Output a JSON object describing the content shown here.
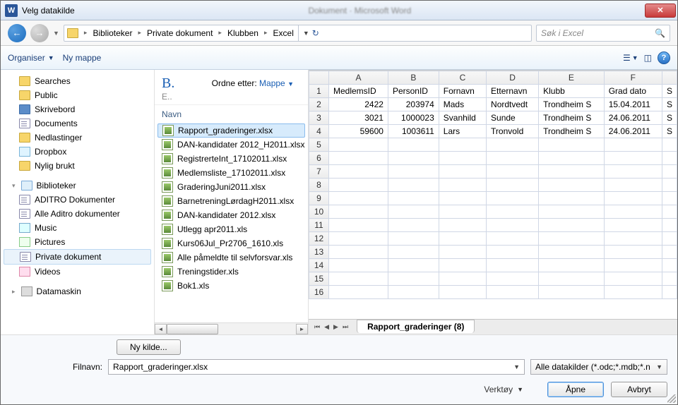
{
  "window": {
    "title": "Velg datakilde"
  },
  "address": {
    "crumbs": [
      "Biblioteker",
      "Private dokument",
      "Klubben",
      "Excel"
    ],
    "search_placeholder": "Søk i Excel"
  },
  "toolbar": {
    "organize": "Organiser",
    "new_folder": "Ny mappe"
  },
  "nav": {
    "items_top": [
      {
        "label": "Searches",
        "iconClass": "ico-folder"
      },
      {
        "label": "Public",
        "iconClass": "ico-folder"
      },
      {
        "label": "Skrivebord",
        "iconClass": "ico-desktop"
      },
      {
        "label": "Documents",
        "iconClass": "ico-doc-lib"
      },
      {
        "label": "Nedlastinger",
        "iconClass": "ico-folder"
      },
      {
        "label": "Dropbox",
        "iconClass": "ico-dropbox"
      },
      {
        "label": "Nylig brukt",
        "iconClass": "ico-folder"
      }
    ],
    "lib_heading": "Biblioteker",
    "lib_items": [
      {
        "label": "ADITRO Dokumenter",
        "iconClass": "ico-doc-lib"
      },
      {
        "label": "Alle Aditro dokumenter",
        "iconClass": "ico-doc-lib"
      },
      {
        "label": "Music",
        "iconClass": "ico-music"
      },
      {
        "label": "Pictures",
        "iconClass": "ico-pic"
      },
      {
        "label": "Private dokument",
        "iconClass": "ico-doc-lib",
        "selected": true
      },
      {
        "label": "Videos",
        "iconClass": "ico-vid"
      }
    ],
    "computer_heading": "Datamaskin"
  },
  "file_pane": {
    "title_initial": "B.",
    "subtitle": "E..",
    "sort_label": "Ordne etter:",
    "sort_field": "Mappe",
    "col_name": "Navn",
    "files": [
      {
        "name": "Rapport_graderinger.xlsx",
        "selected": true
      },
      {
        "name": "DAN-kandidater 2012_H2011.xlsx"
      },
      {
        "name": "RegistrerteInt_17102011.xlsx"
      },
      {
        "name": "Medlemsliste_17102011.xlsx"
      },
      {
        "name": "GraderingJuni2011.xlsx"
      },
      {
        "name": "BarnetreningLørdagH2011.xlsx"
      },
      {
        "name": "DAN-kandidater 2012.xlsx"
      },
      {
        "name": "Utlegg apr2011.xls"
      },
      {
        "name": "Kurs06Jul_Pr2706_1610.xls"
      },
      {
        "name": "Alle påmeldte til selvforsvar.xls"
      },
      {
        "name": "Treningstider.xls"
      },
      {
        "name": "Bok1.xls"
      }
    ]
  },
  "preview": {
    "cols": [
      "A",
      "B",
      "C",
      "D",
      "E",
      "F"
    ],
    "last_col_fragment": "S",
    "headers": {
      "A": "MedlemsID",
      "B": "PersonID",
      "C": "Fornavn",
      "D": "Etternavn",
      "E": "Klubb",
      "F": "Grad dato",
      "G": "Sk"
    },
    "rows": [
      {
        "A": "2422",
        "B": "203974",
        "C": "Mads",
        "D": "Nordtvedt",
        "E": "Trondheim S",
        "F": "15.04.2011",
        "G": "Sk"
      },
      {
        "A": "3021",
        "B": "1000023",
        "C": "Svanhild",
        "D": "Sunde",
        "E": "Trondheim S",
        "F": "24.06.2011",
        "G": "Sk"
      },
      {
        "A": "59600",
        "B": "1003611",
        "C": "Lars",
        "D": "Tronvold",
        "E": "Trondheim S",
        "F": "24.06.2011",
        "G": "Sk"
      }
    ],
    "row_count_visible": 16,
    "sheet_tab": "Rapport_graderinger (8)"
  },
  "footer": {
    "new_source": "Ny kilde...",
    "filename_label": "Filnavn:",
    "filename_value": "Rapport_graderinger.xlsx",
    "filter_value": "Alle datakilder (*.odc;*.mdb;*.n",
    "tools": "Verktøy",
    "open": "Åpne",
    "cancel": "Avbryt"
  }
}
